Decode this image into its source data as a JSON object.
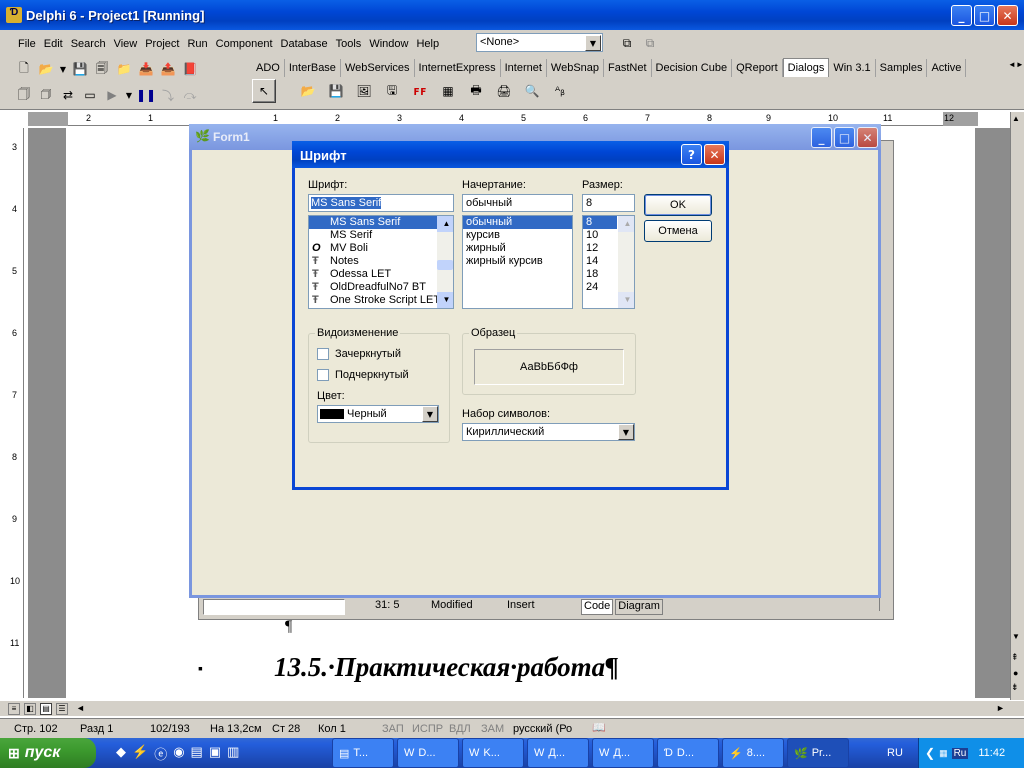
{
  "ide": {
    "title": "Delphi 6 - Project1 [Running]",
    "menu": [
      "File",
      "Edit",
      "Search",
      "View",
      "Project",
      "Run",
      "Component",
      "Database",
      "Tools",
      "Window",
      "Help"
    ],
    "combo_value": "<None>",
    "palette_tabs": [
      "ADO",
      "InterBase",
      "WebServices",
      "InternetExpress",
      "Internet",
      "WebSnap",
      "FastNet",
      "Decision Cube",
      "QReport",
      "Dialogs",
      "Win 3.1",
      "Samples",
      "Active"
    ],
    "selected_tab": "Dialogs"
  },
  "ruler": {
    "top": [
      "2",
      "1",
      "1",
      "2",
      "3",
      "4",
      "5",
      "6",
      "7",
      "8",
      "9",
      "10",
      "11",
      "12"
    ],
    "left": [
      "3",
      "4",
      "5",
      "6",
      "7",
      "8",
      "9",
      "10",
      "11"
    ]
  },
  "form1": {
    "title": "Form1"
  },
  "editor_status": {
    "pos": "31:   5",
    "state": "Modified",
    "mode": "Insert",
    "tabs": [
      "Code",
      "Diagram"
    ]
  },
  "dialog": {
    "title": "Шрифт",
    "font_label": "Шрифт:",
    "font_value": "MS Sans Serif",
    "fonts": [
      "MS Sans Serif",
      "MS Serif",
      "MV Boli",
      "Notes",
      "Odessa LET",
      "OldDreadfulNo7 BT",
      "One Stroke Script LET"
    ],
    "style_label": "Начертание:",
    "style_value": "обычный",
    "styles": [
      "обычный",
      "курсив",
      "жирный",
      "жирный курсив"
    ],
    "size_label": "Размер:",
    "size_value": "8",
    "sizes": [
      "8",
      "10",
      "12",
      "14",
      "18",
      "24"
    ],
    "ok": "OK",
    "cancel": "Отмена",
    "effects_label": "Видоизменение",
    "strike": "Зачеркнутый",
    "underline": "Подчеркнутый",
    "color_label": "Цвет:",
    "color_value": "Черный",
    "sample_label": "Образец",
    "sample_text": "АаBbБбФф",
    "charset_label": "Набор символов:",
    "charset_value": "Кириллический"
  },
  "doc": {
    "pilcrow": "¶",
    "heading": "13.5.·Практическая·работа¶"
  },
  "word_status": {
    "page": "Стр.  102",
    "section": "Разд  1",
    "pages": "102/193",
    "at": "На  13,2см",
    "line": "Ст  28",
    "col": "Кол  1",
    "rec": "ЗАП",
    "trk": "ИСПР",
    "ext": "ВДЛ",
    "ovr": "ЗАМ",
    "lang": "русский (Ро"
  },
  "taskbar": {
    "start": "пуск",
    "tasks": [
      "T...",
      "D...",
      "K...",
      "Д...",
      "Д...",
      "D...",
      "8....",
      "Pr..."
    ],
    "lang": "RU",
    "ime": "Ru",
    "clock": "11:42"
  },
  "colors": {
    "xp_blue": "#0a5fe6",
    "taskbar": "#245edb",
    "start": "#3c9a2e",
    "selection": "#316ac5"
  }
}
